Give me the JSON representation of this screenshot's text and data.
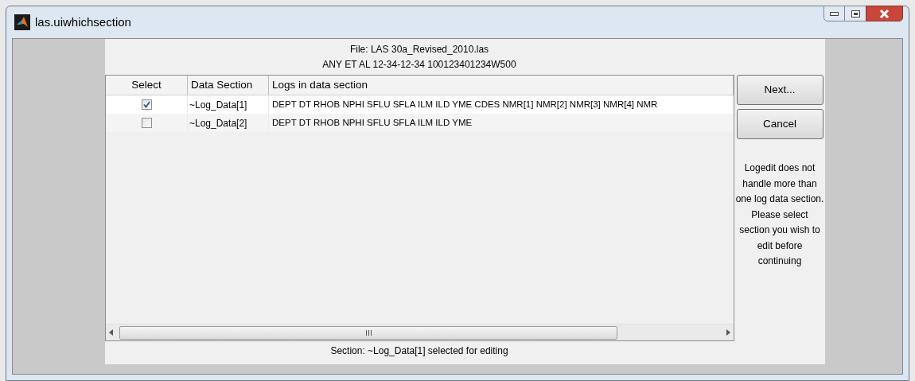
{
  "window": {
    "title": "las.uiwhichsection"
  },
  "file_info": [
    "File: LAS 30a_Revised_2010.las",
    "ANY ET AL 12-34-12-34 100123401234W500"
  ],
  "table": {
    "columns": [
      "Select",
      "Data Section",
      "Logs in data section"
    ],
    "rows": [
      {
        "checked": true,
        "section": "~Log_Data[1]",
        "logs": "DEPT DT RHOB NPHI SFLU SFLA ILM ILD YME CDES NMR[1] NMR[2] NMR[3] NMR[4] NMR"
      },
      {
        "checked": false,
        "section": "~Log_Data[2]",
        "logs": "DEPT DT RHOB NPHI SFLU SFLA ILM ILD YME"
      }
    ]
  },
  "buttons": [
    "Next...",
    "Cancel"
  ],
  "message": "Logedit does not handle more than one log data section. Please select section you wish to edit before continuing",
  "status": "Section: ~Log_Data[1] selected for editing"
}
